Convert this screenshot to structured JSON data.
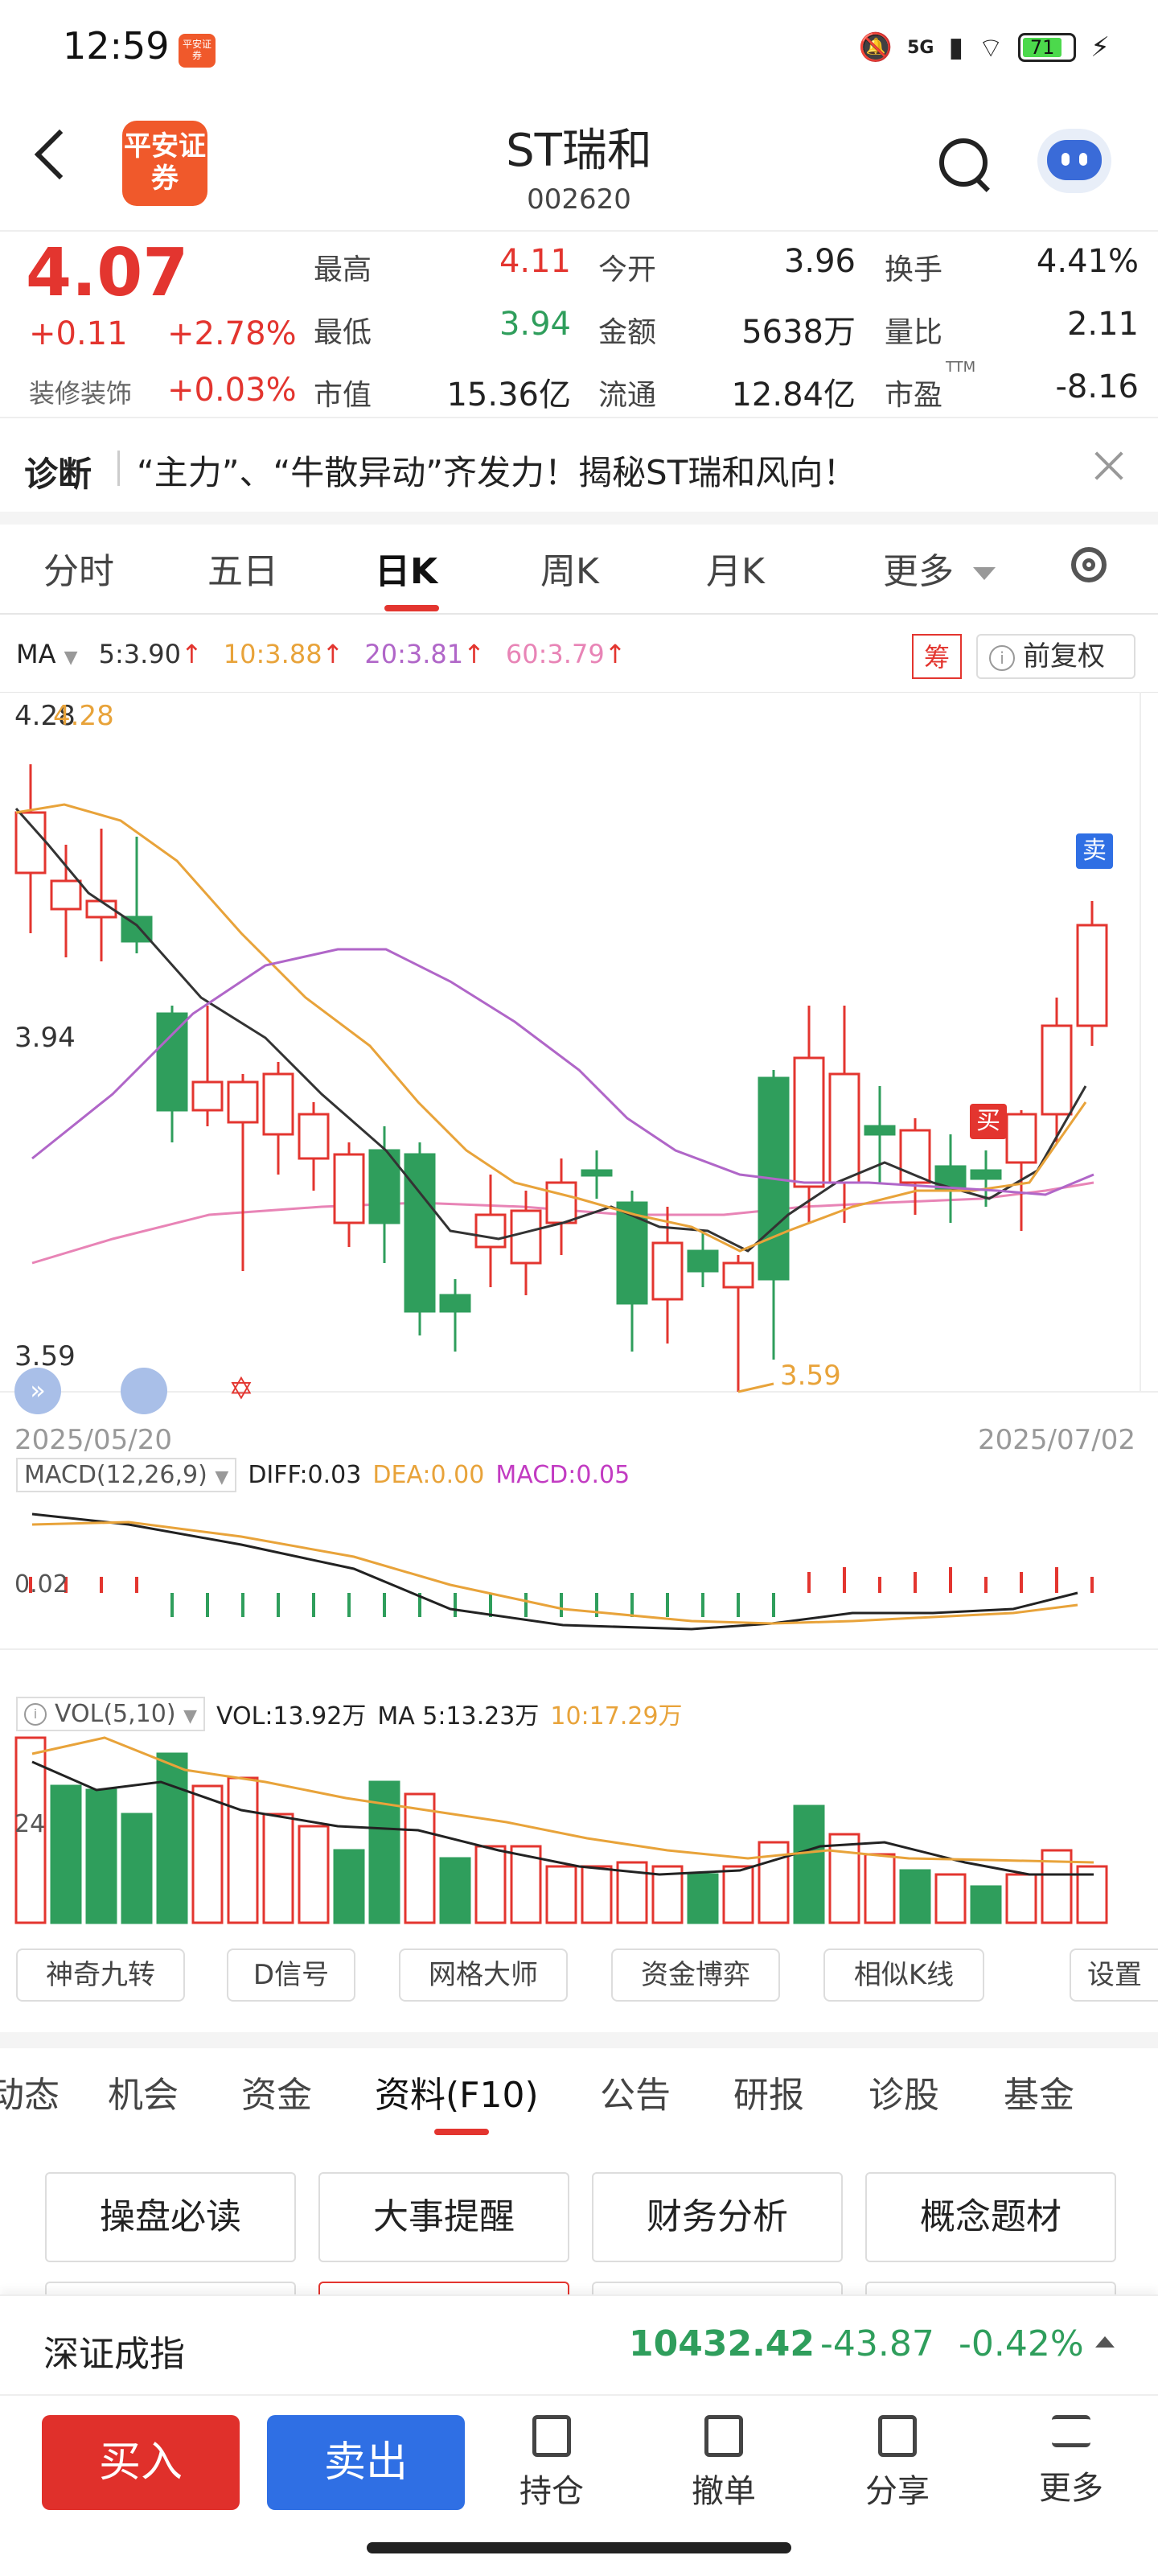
{
  "status_bar": {
    "time": "12:59",
    "app_badge": "平安证券",
    "network": "5G",
    "battery": "71"
  },
  "header": {
    "logo_text": "平安证券",
    "title": "ST瑞和",
    "code": "002620"
  },
  "quote": {
    "price": "4.07",
    "change": "+0.11",
    "change_pct": "+2.78%",
    "industry": "装修装饰",
    "industry_pct": "+0.03%",
    "stats": [
      {
        "label": "最高",
        "value": "4.11",
        "tone": "red"
      },
      {
        "label": "今开",
        "value": "3.96",
        "tone": "dark"
      },
      {
        "label": "换手",
        "value": "4.41%",
        "tone": "dark"
      },
      {
        "label": "最低",
        "value": "3.94",
        "tone": "green"
      },
      {
        "label": "金额",
        "value": "5638万",
        "tone": "dark"
      },
      {
        "label": "量比",
        "value": "2.11",
        "tone": "dark"
      },
      {
        "label": "市值",
        "value": "15.36亿",
        "tone": "dark"
      },
      {
        "label": "流通",
        "value": "12.84亿",
        "tone": "dark"
      },
      {
        "label": "市盈",
        "value": "-8.16",
        "tone": "dark"
      }
    ],
    "ttm_label": "TTM"
  },
  "diagnosis": {
    "label": "诊断",
    "text": "“主力”、“牛散异动”齐发力！揭秘ST瑞和风向！"
  },
  "period_tabs": {
    "items": [
      "分时",
      "五日",
      "日K",
      "周K",
      "月K",
      "更多"
    ],
    "active": "日K"
  },
  "ma_legend": {
    "label": "MA",
    "ma5": "5:3.90",
    "ma10": "10:3.88",
    "ma20": "20:3.81",
    "ma60": "60:3.79",
    "chou_label": "筹",
    "fuquan_label": "前复权"
  },
  "kline": {
    "top_label": "4.28",
    "top_label2": "4.28",
    "mid_label": "3.94",
    "bottom_label": "3.59",
    "low_marker": "3.59",
    "start_date": "2025/05/20",
    "end_date": "2025/07/02",
    "sell_marker": "卖",
    "buy_marker": "买"
  },
  "macd": {
    "label": "MACD(12,26,9)",
    "diff": "DIFF:0.03",
    "dea": "DEA:0.00",
    "macd": "MACD:0.05",
    "axis_label": "0.02"
  },
  "vol": {
    "label": "VOL(5,10)",
    "vol": "VOL:13.92万",
    "ma5": "MA 5:13.23万",
    "ma10": "10:17.29万",
    "axis_label": "24"
  },
  "tools": [
    "神奇九转",
    "D信号",
    "网格大师",
    "资金博弈",
    "相似K线",
    "设置"
  ],
  "section_tabs": {
    "items": [
      "动态",
      "机会",
      "资金",
      "资料(F10)",
      "公告",
      "研报",
      "诊股",
      "基金"
    ],
    "active": "资料(F10)"
  },
  "f10_buttons": [
    "操盘必读",
    "大事提醒",
    "财务分析",
    "概念题材"
  ],
  "index_bar": {
    "name": "深证成指",
    "value": "10432.42",
    "change": "-43.87",
    "pct": "-0.42%"
  },
  "bottom_bar": {
    "buy": "买入",
    "sell": "卖出",
    "hold": "持仓",
    "cancel": "撤单",
    "share": "分享",
    "more": "更多"
  },
  "colors": {
    "up": "#e3352f",
    "down": "#2f9e5c",
    "ma5": "#333333",
    "ma10": "#e8a33a",
    "ma20": "#b066c8",
    "ma60": "#e884b6",
    "accent": "#f0592b",
    "sell_blue": "#2f6fe4"
  }
}
